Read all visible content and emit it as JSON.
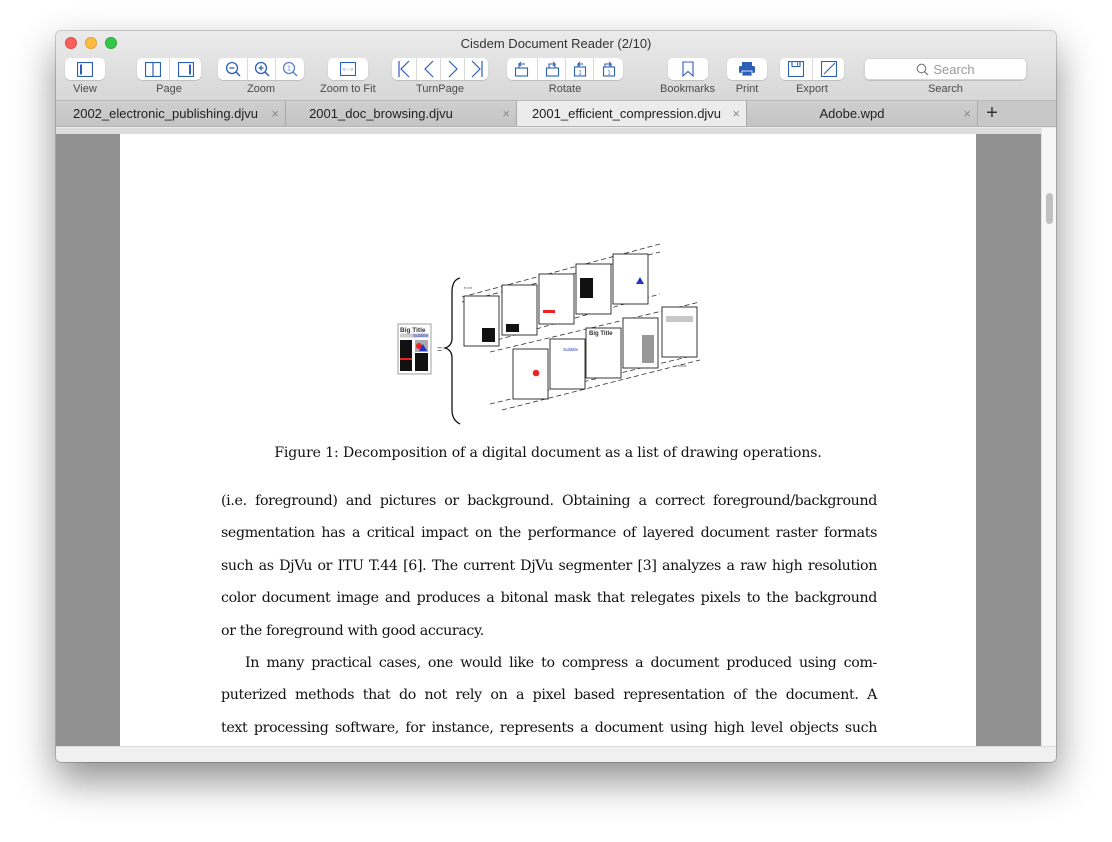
{
  "window": {
    "title": "Cisdem Document Reader (2/10)"
  },
  "toolbar": {
    "groups": [
      {
        "label": "View",
        "buttons": [
          "sidebar-toggle-icon"
        ]
      },
      {
        "label": "Page",
        "buttons": [
          "two-page-icon",
          "single-page-icon"
        ]
      },
      {
        "label": "Zoom",
        "buttons": [
          "zoom-out-icon",
          "zoom-in-icon",
          "actual-size-icon"
        ]
      },
      {
        "label": "Zoom to Fit",
        "buttons": [
          "fit-width-icon"
        ]
      },
      {
        "label": "TurnPage",
        "buttons": [
          "first-page-icon",
          "previous-page-icon",
          "next-page-icon",
          "last-page-icon"
        ]
      },
      {
        "label": "Rotate",
        "buttons": [
          "rotate-left-icon",
          "rotate-right-icon",
          "rotate-page-left-icon",
          "rotate-page-right-icon"
        ]
      },
      {
        "label": "Bookmarks",
        "buttons": [
          "bookmark-icon"
        ]
      },
      {
        "label": "Print",
        "buttons": [
          "printer-icon"
        ]
      },
      {
        "label": "Export",
        "buttons": [
          "save-icon",
          "edit-export-icon"
        ]
      },
      {
        "label": "Search"
      }
    ],
    "search_placeholder": "Search",
    "accent_color": "#2c5fb8"
  },
  "tabs": [
    {
      "label": "2002_electronic_publishing.djvu",
      "active": false
    },
    {
      "label": "2001_doc_browsing.djvu",
      "active": false
    },
    {
      "label": "2001_efficient_compression.djvu",
      "active": true
    },
    {
      "label": "Adobe.wpd",
      "active": false
    }
  ],
  "tab_close_glyph": "×",
  "tab_add_glyph": "+",
  "document": {
    "figure": {
      "composite_title": "Big Title",
      "composite_subtitle": "Subtitle",
      "layer_label_front": "front",
      "layer_label_back": "back",
      "layer_title": "Big Title",
      "layer_subtitle": "Subtitle",
      "equals": "="
    },
    "caption": "Figure 1: Decomposition of a digital document as a list of drawing operations.",
    "lines": [
      "(i.e. foreground) and pictures or background. Obtaining a correct foreground/background",
      "segmentation has a critical impact on the performance of layered document raster formats",
      "such as DjVu or ITU T.44 [6]. The current DjVu segmenter [3] analyzes a raw high resolution",
      "color document image and produces a bitonal mask that relegates pixels to the background",
      "or the foreground with good accuracy.",
      "In many practical cases, one would like to compress a document produced using com-",
      "puterized methods that do not rely on a pixel based representation of the document. A",
      "text processing software, for instance, represents a document using high level objects such"
    ]
  }
}
